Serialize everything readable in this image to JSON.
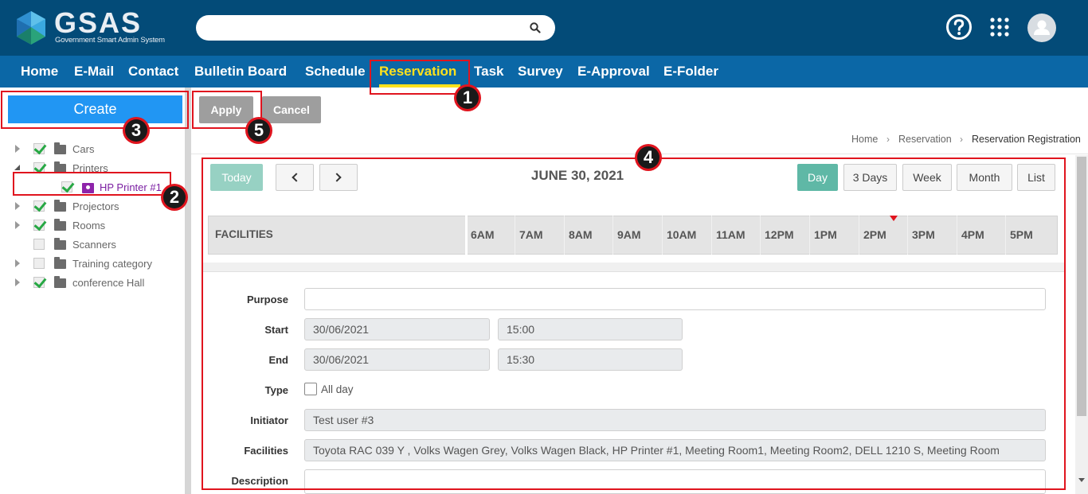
{
  "header": {
    "logo_title": "GSAS",
    "logo_subtitle": "Government Smart Admin System",
    "search_placeholder": ""
  },
  "nav": {
    "items": [
      {
        "label": "Home"
      },
      {
        "label": "E-Mail"
      },
      {
        "label": "Contact"
      },
      {
        "label": "Bulletin Board"
      },
      {
        "label": "Schedule"
      },
      {
        "label": "Reservation",
        "active": true
      },
      {
        "label": "Task"
      },
      {
        "label": "Survey"
      },
      {
        "label": "E-Approval"
      },
      {
        "label": "E-Folder"
      }
    ]
  },
  "annotations": [
    "1",
    "2",
    "3",
    "4",
    "5"
  ],
  "sidebar": {
    "create_label": "Create",
    "tree": [
      {
        "label": "Cars",
        "checked": true,
        "expanded": false
      },
      {
        "label": "Printers",
        "checked": true,
        "expanded": true
      },
      {
        "label": "HP Printer #1",
        "checked": true,
        "child": true
      },
      {
        "label": "Projectors",
        "checked": true,
        "expanded": false
      },
      {
        "label": "Rooms",
        "checked": true,
        "expanded": false
      },
      {
        "label": "Scanners",
        "checked": false,
        "expanded": false
      },
      {
        "label": "Training category",
        "checked": false,
        "expanded": false
      },
      {
        "label": "conference Hall",
        "checked": true,
        "expanded": false
      }
    ]
  },
  "toolbar": {
    "apply_label": "Apply",
    "cancel_label": "Cancel"
  },
  "breadcrumb": [
    "Home",
    "Reservation",
    "Reservation Registration"
  ],
  "calendar": {
    "today_label": "Today",
    "date_title": "JUNE 30, 2021",
    "views": [
      "Day",
      "3 Days",
      "Week",
      "Month",
      "List"
    ],
    "active_view": "Day",
    "facilities_header": "FACILITIES",
    "hours": [
      "6AM",
      "7AM",
      "8AM",
      "9AM",
      "10AM",
      "11AM",
      "12PM",
      "1PM",
      "2PM",
      "3PM",
      "4PM",
      "5PM"
    ]
  },
  "form": {
    "purpose_label": "Purpose",
    "purpose_value": "",
    "start_label": "Start",
    "start_date": "30/06/2021",
    "start_time": "15:00",
    "end_label": "End",
    "end_date": "30/06/2021",
    "end_time": "15:30",
    "type_label": "Type",
    "allday_label": "All day",
    "allday_checked": false,
    "initiator_label": "Initiator",
    "initiator_value": "Test user #3",
    "facilities_label": "Facilities",
    "facilities_value": "Toyota  RAC 039 Y , Volks Wagen Grey, Volks Wagen Black, HP Printer #1, Meeting Room1, Meeting Room2, DELL 1210 S, Meeting Room",
    "description_label": "Description",
    "description_value": ""
  },
  "colors": {
    "header_bg": "#034b78",
    "nav_bg": "#0b67a6",
    "active_nav": "#ffe21c",
    "create_btn": "#2196f3",
    "annotation_red": "#e0141e",
    "view_active": "#5fb8a6"
  }
}
